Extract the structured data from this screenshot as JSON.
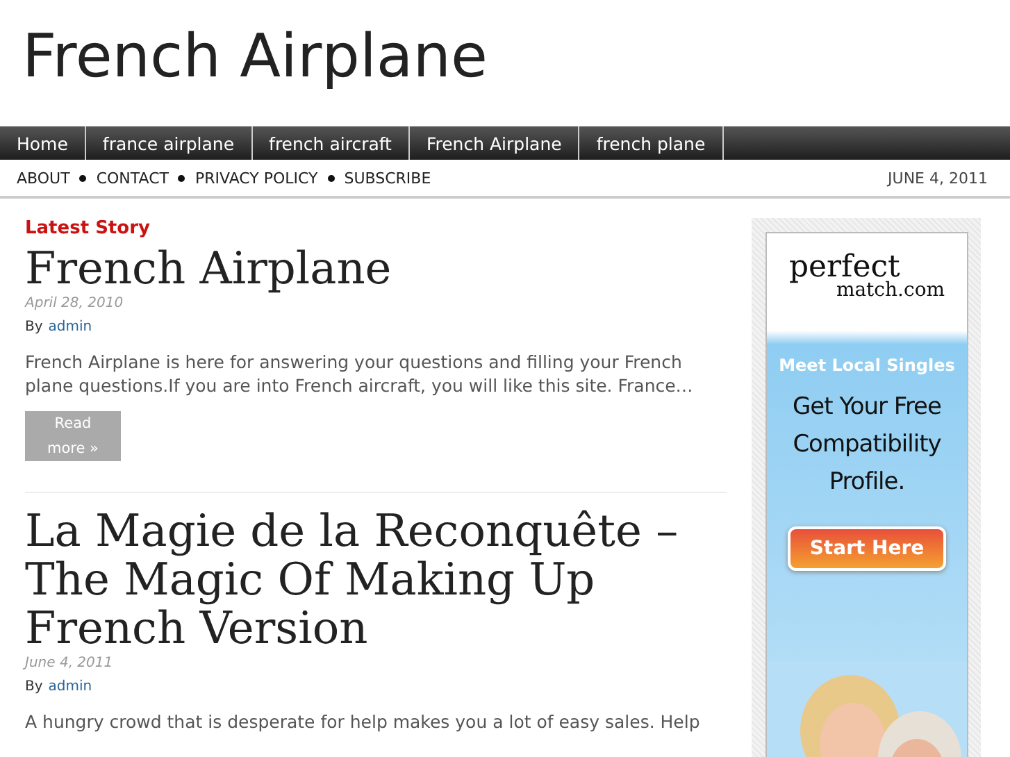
{
  "site_title": "French Airplane",
  "nav": [
    "Home",
    "france airplane",
    "french aircraft",
    "French Airplane",
    "french plane"
  ],
  "subnav": [
    "ABOUT",
    "CONTACT",
    "PRIVACY POLICY",
    "SUBSCRIBE"
  ],
  "date": "JUNE 4, 2011",
  "section_label": "Latest Story",
  "posts": [
    {
      "title": "French Airplane",
      "date": "April 28, 2010",
      "by": "By",
      "author": "admin",
      "excerpt": "French Airplane is here for answering your questions and filling your French plane questions.If you are into French aircraft, you will like this site. France…",
      "read_more": [
        "Read",
        "more »"
      ]
    },
    {
      "title": "La Magie de la Reconquête – The Magic Of Making Up French Version",
      "date": "June 4, 2011",
      "by": "By",
      "author": "admin",
      "excerpt": "A hungry crowd that is desperate for help makes you a lot of easy sales. Help"
    }
  ],
  "ad": {
    "logo_top": "perfect",
    "logo_bottom": "match.com",
    "headline": "Meet Local Singles",
    "body": "Get Your Free Compatibility Profile.",
    "button": "Start Here"
  }
}
